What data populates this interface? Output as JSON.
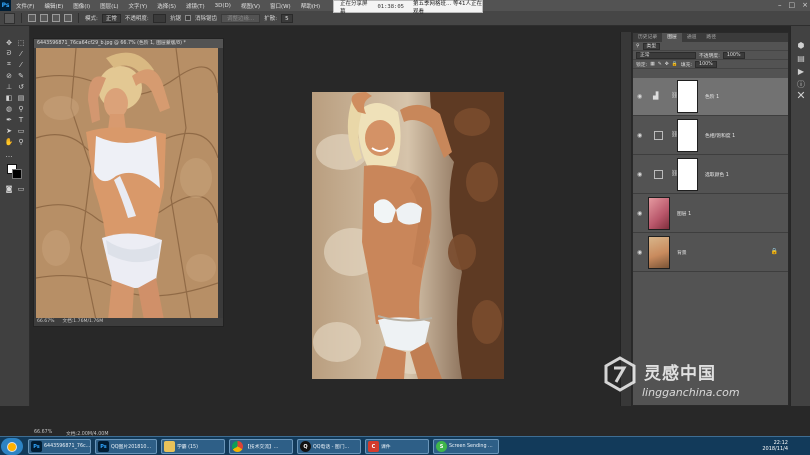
{
  "menubar": {
    "items": [
      "文件(F)",
      "编辑(E)",
      "图像(I)",
      "图层(L)",
      "文字(Y)",
      "选择(S)",
      "滤镜(T)",
      "3D(D)",
      "视图(V)",
      "窗口(W)",
      "帮助(H)"
    ]
  },
  "recording": {
    "status": "正在分享屏幕",
    "time": "01:38:05",
    "extra": "第五季网格班... 等41人正在观看"
  },
  "options_bar": {
    "mode_label": "模式:",
    "mode_value": "正常",
    "opacity_label": "不透明度:",
    "fill_label": "抗锯",
    "checkbox_label": "消除锯齿",
    "disabled_button": "调整边缘...",
    "flow_label": "扩散:",
    "flow_value": "5"
  },
  "documents": {
    "left": {
      "title": "6443596871_76ca64cf29_b.jpg @ 66.7% (色阶 1, 图层蒙版/8) *",
      "zoom": "66.67%",
      "doc_size": "文档:1.76M/1.76M"
    }
  },
  "layers_panel": {
    "tabs": [
      "历史记录",
      "图层",
      "通道",
      "路径"
    ],
    "active_tab": "图层",
    "kind_label": "类型",
    "blend_mode": "正常",
    "opacity_label": "不透明度:",
    "opacity_value": "100%",
    "lock_label": "锁定:",
    "fill_label": "填充:",
    "fill_value": "100%",
    "layers": [
      {
        "name": "色阶 1",
        "kind": "adjustment",
        "selected": true
      },
      {
        "name": "色相/饱和度 1",
        "kind": "adjustment",
        "selected": false
      },
      {
        "name": "选取颜色 1",
        "kind": "adjustment",
        "selected": false
      },
      {
        "name": "图层 1",
        "kind": "pixel",
        "selected": false
      },
      {
        "name": "背景",
        "kind": "background",
        "selected": false
      }
    ]
  },
  "app_status": {
    "zoom": "66.67%",
    "doc_size": "文档:2.00M/4.00M"
  },
  "taskbar": {
    "items": [
      {
        "label": "6443596871_76c...",
        "icon": "ps"
      },
      {
        "label": "QQ图片201810...",
        "icon": "ps"
      },
      {
        "label": "学霸 (15)",
        "icon": "folder"
      },
      {
        "label": "【技术交流】...",
        "icon": "chrome"
      },
      {
        "label": "QQ电话 - 图门...",
        "icon": "qq"
      },
      {
        "label": "课件",
        "icon": "red"
      },
      {
        "label": "Screen Sending ...",
        "icon": "green"
      }
    ],
    "clock_time": "22:12",
    "clock_date": "2018/11/4"
  },
  "watermark": {
    "cn": "灵感中国",
    "en": "lingganchina.com"
  },
  "colors": {
    "ps_bg": "#282828",
    "panel": "#535353",
    "taskbar": "#123a5a",
    "selected_layer": "#727272"
  }
}
